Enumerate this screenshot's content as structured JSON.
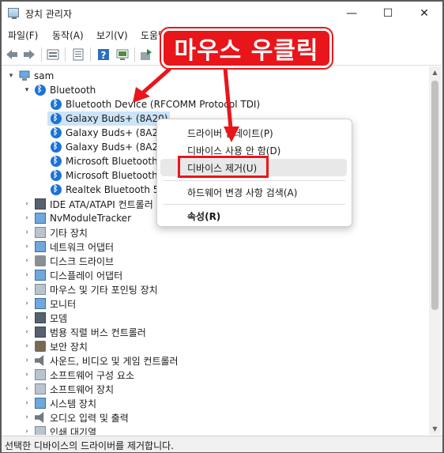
{
  "window": {
    "title": "장치 관리자",
    "controls": {
      "minimize": "—",
      "maximize": "☐",
      "close": "✕"
    }
  },
  "menu": [
    "파일(F)",
    "동작(A)",
    "보기(V)",
    "도움말"
  ],
  "tree": {
    "root": "sam",
    "bluetooth": {
      "label": "Bluetooth",
      "children": [
        "Bluetooth Device (RFCOMM Protocol TDI)",
        "Galaxy Buds+ (8A20)",
        "Galaxy Buds+ (8A20)",
        "Galaxy Buds+ (8A20)",
        "Microsoft Bluetooth L",
        "Microsoft Bluetooth",
        "Realtek Bluetooth 5.0"
      ]
    },
    "categories": [
      "IDE ATA/ATAPI 컨트롤러",
      "NvModuleTracker",
      "기타 장치",
      "네트워크 어댑터",
      "디스크 드라이브",
      "디스플레이 어댑터",
      "마우스 및 기타 포인팅 장치",
      "모니터",
      "모뎀",
      "범용 직렬 버스 컨트롤러",
      "보안 장치",
      "사운드, 비디오 및 게임 컨트롤러",
      "소프트웨어 구성 요소",
      "소프트웨어 장치",
      "시스템 장치",
      "오디오 입력 및 출력",
      "인쇄 대기열"
    ]
  },
  "context_menu": {
    "update_driver": "드라이버 업데이트(P)",
    "disable_device": "디바이스 사용 안 함(D)",
    "uninstall_device": "디바이스 제거(U)",
    "scan_hardware": "하드웨어 변경 사항 검색(A)",
    "properties": "속성(R)"
  },
  "annotation": {
    "banner": "마우스 우클릭",
    "color": "#e8161b"
  },
  "status": "선택한 디바이스의 드라이버를 제거합니다."
}
